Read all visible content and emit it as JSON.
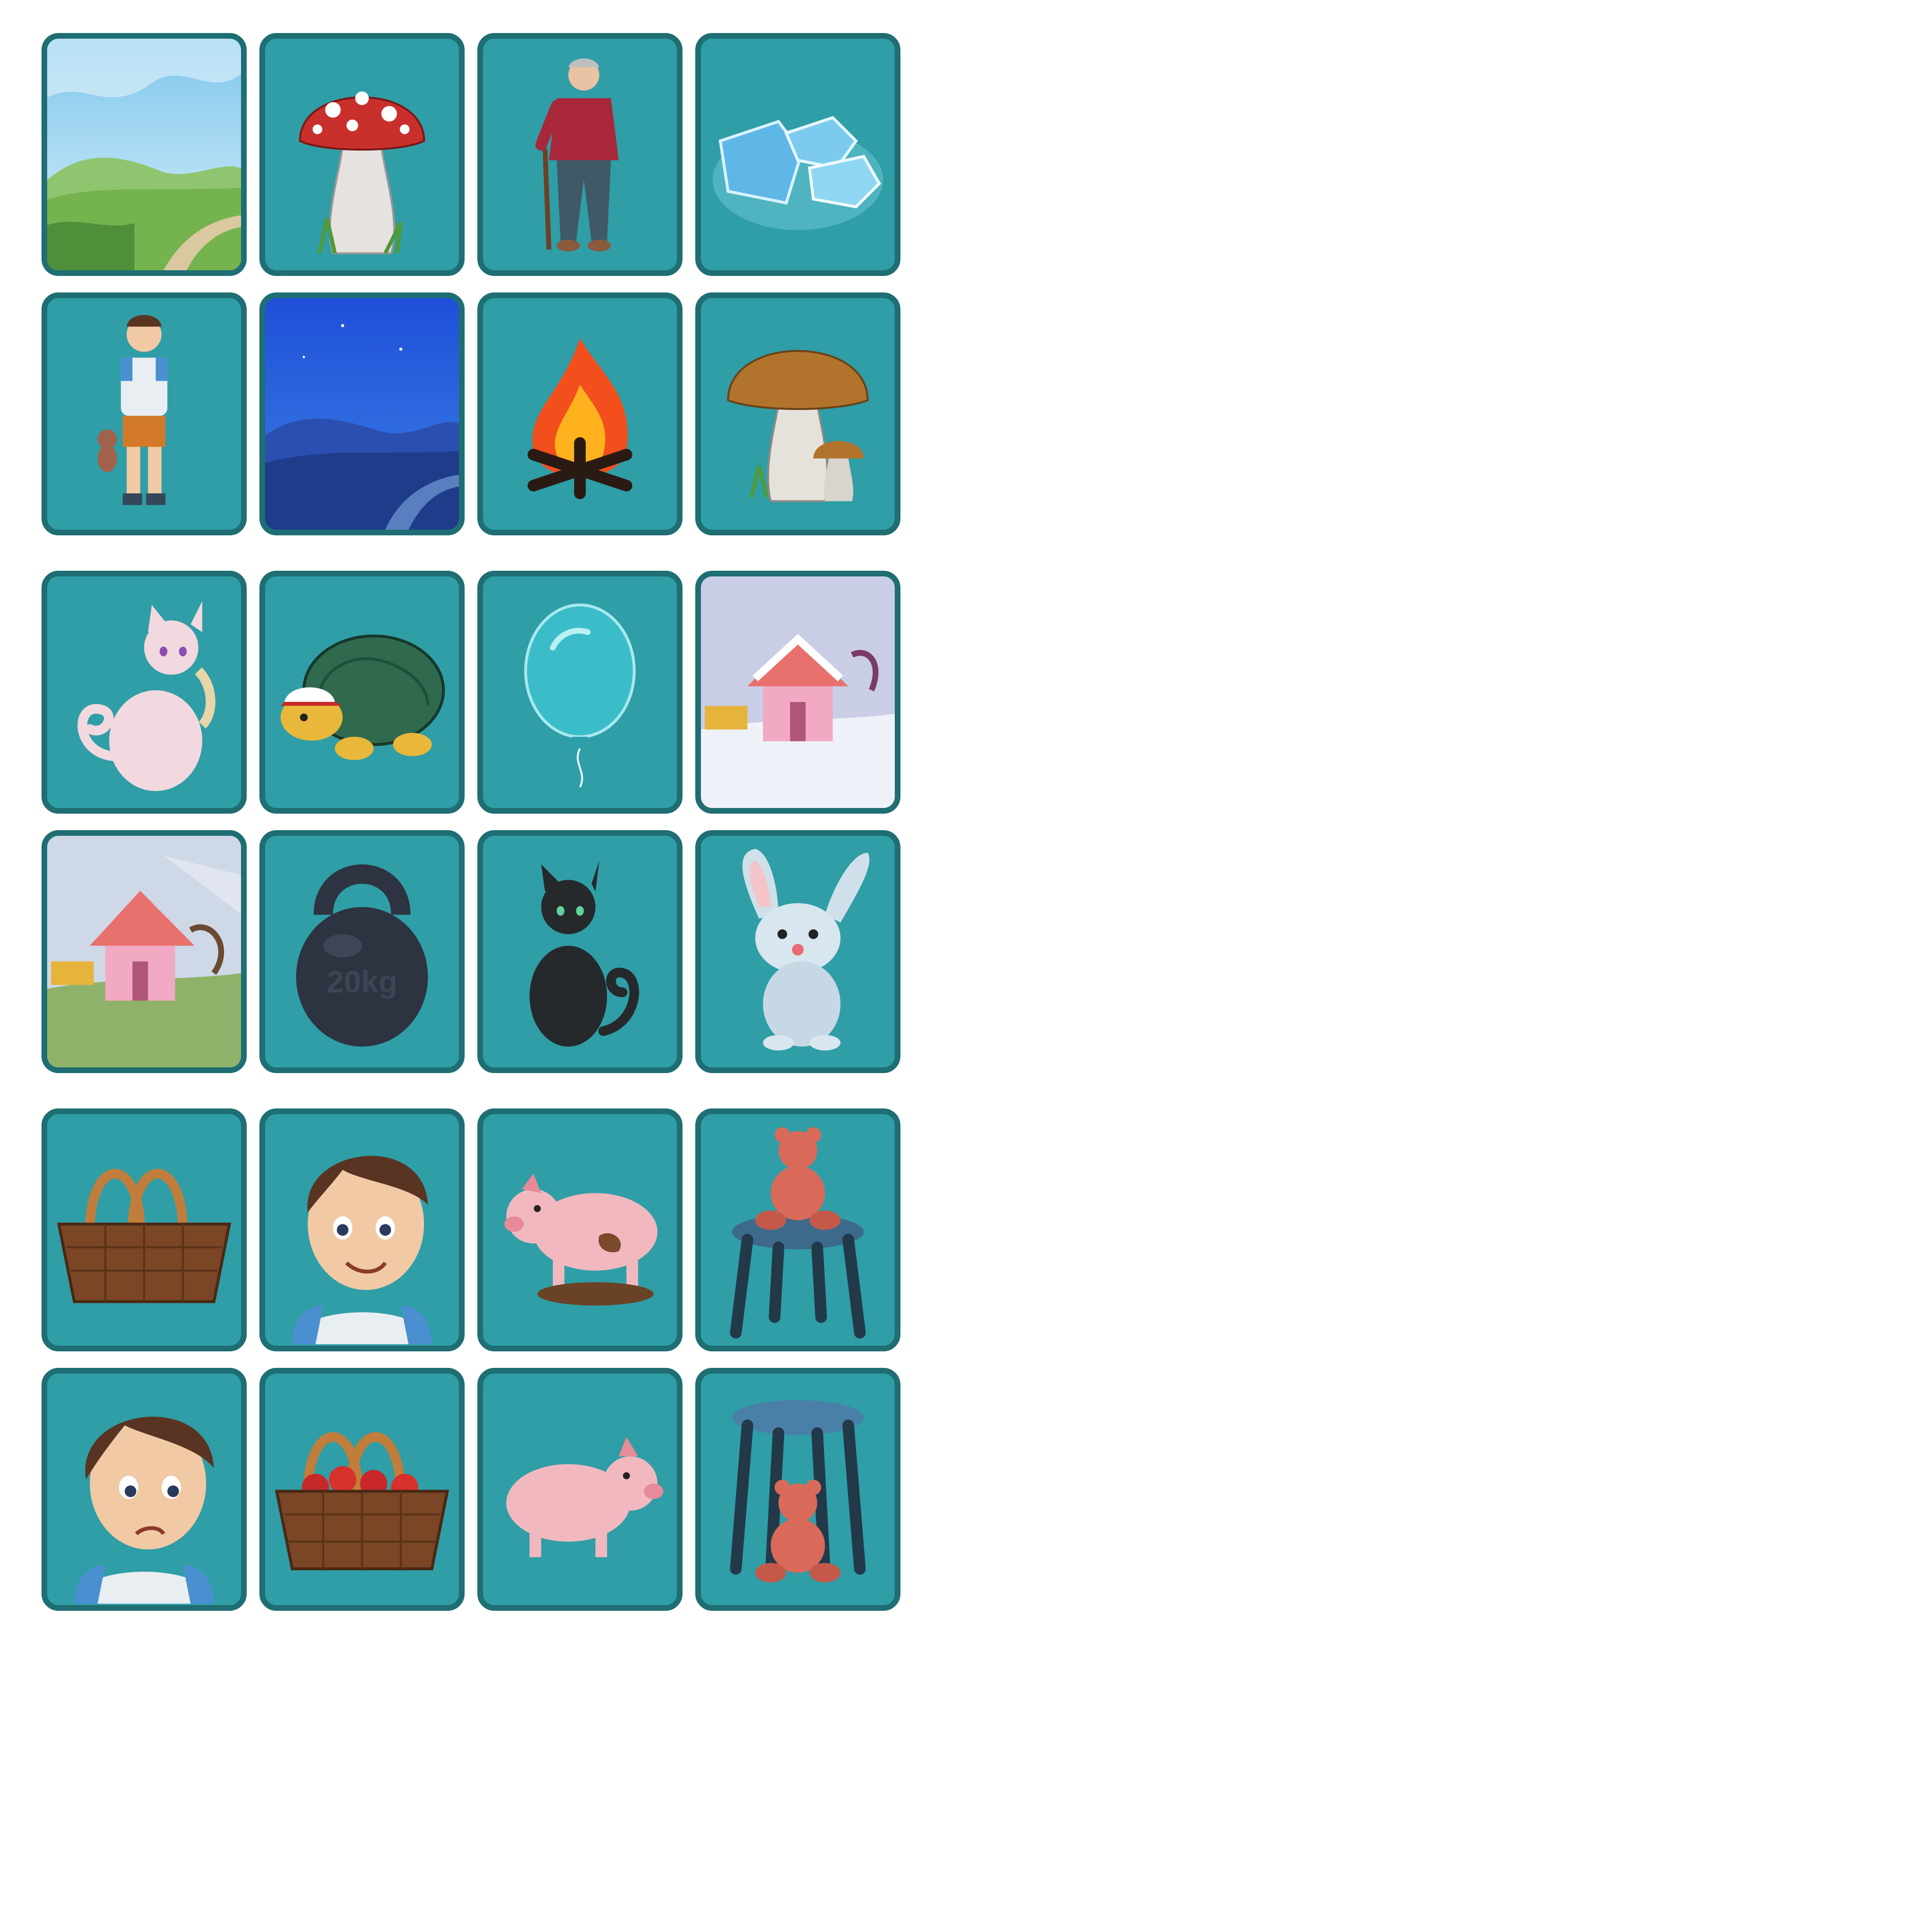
{
  "board": {
    "card_background": "#2f9ea6",
    "card_border": "#1e6e73",
    "groups": [
      {
        "name": "pairs-1",
        "cards": [
          {
            "icon": "meadow-day-icon"
          },
          {
            "icon": "red-mushroom-icon"
          },
          {
            "icon": "old-man-icon"
          },
          {
            "icon": "ice-cubes-icon"
          },
          {
            "icon": "boy-with-teddy-icon"
          },
          {
            "icon": "meadow-night-icon"
          },
          {
            "icon": "campfire-icon"
          },
          {
            "icon": "brown-mushroom-icon"
          }
        ]
      },
      {
        "name": "pairs-2",
        "cards": [
          {
            "icon": "white-cat-icon"
          },
          {
            "icon": "turtle-icon"
          },
          {
            "icon": "balloon-icon"
          },
          {
            "icon": "house-winter-icon"
          },
          {
            "icon": "house-summer-icon"
          },
          {
            "icon": "kettlebell-icon",
            "label": "20kg"
          },
          {
            "icon": "black-cat-icon"
          },
          {
            "icon": "bunny-icon"
          }
        ]
      },
      {
        "name": "pairs-3",
        "cards": [
          {
            "icon": "empty-basket-icon"
          },
          {
            "icon": "boy-smiling-icon"
          },
          {
            "icon": "muddy-pig-icon"
          },
          {
            "icon": "teddy-on-stool-icon"
          },
          {
            "icon": "boy-sad-icon"
          },
          {
            "icon": "basket-apples-icon"
          },
          {
            "icon": "clean-pig-icon"
          },
          {
            "icon": "teddy-under-stool-icon"
          }
        ]
      }
    ]
  }
}
